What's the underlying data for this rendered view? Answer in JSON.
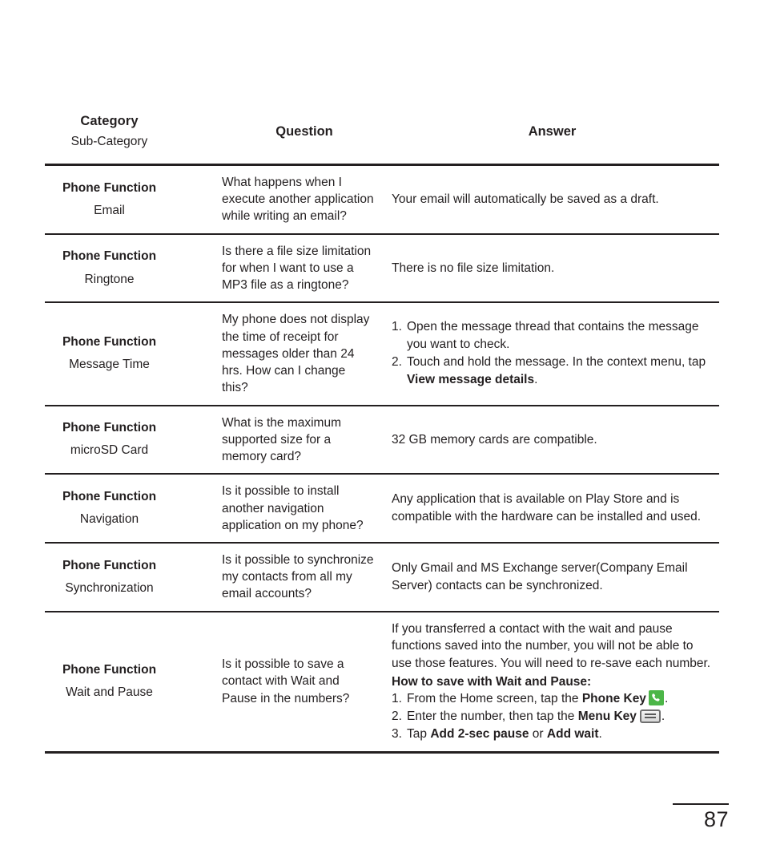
{
  "page": {
    "number": "87"
  },
  "table": {
    "headers": {
      "category": "Category",
      "sub_category": "Sub-Category",
      "question": "Question",
      "answer": "Answer"
    },
    "rows": [
      {
        "category": "Phone Function",
        "sub_category": "Email",
        "question": "What happens when I execute another application while writing an email?",
        "answer_lines": [
          "Your email will automatically be saved as a draft."
        ]
      },
      {
        "category": "Phone Function",
        "sub_category": "Ringtone",
        "question": "Is there a file size limitation for when I want to use a MP3 file as a ringtone?",
        "answer_lines": [
          "There is no file size limitation."
        ]
      },
      {
        "category": "Phone Function",
        "sub_category": "Message Time",
        "question": "My phone does not display the time of receipt for messages older than 24 hrs. How can I change this?",
        "answer_steps": [
          {
            "num": "1.",
            "text": "Open the message thread that contains the message you want to check."
          },
          {
            "num": "2.",
            "text_before": "Touch and hold the message. In the context menu, tap ",
            "bold": "View message details",
            "text_after": "."
          }
        ]
      },
      {
        "category": "Phone Function",
        "sub_category": "microSD Card",
        "question": "What is the maximum supported size for a memory card?",
        "answer_lines": [
          "32 GB memory cards are compatible."
        ]
      },
      {
        "category": "Phone Function",
        "sub_category": "Navigation",
        "question": "Is it possible to install another navigation application on my phone?",
        "answer_lines": [
          "Any application that is available on Play Store and is compatible with the hardware can be installed and used."
        ]
      },
      {
        "category": "Phone Function",
        "sub_category": "Synchronization",
        "question": "Is it possible to synchronize my contacts from all my email accounts?",
        "answer_lines": [
          "Only Gmail and MS Exchange server(Company Email Server) contacts can be synchronized."
        ]
      },
      {
        "category": "Phone Function",
        "sub_category": "Wait and Pause",
        "question": "Is it possible to save a contact with Wait and Pause in the numbers?",
        "answer_intro": "If you transferred a contact with the wait and pause functions saved into the number, you will not be able to use those features. You will need to re-save each number.",
        "answer_how_heading": "How to save with Wait and Pause:",
        "answer_steps": [
          {
            "num": "1.",
            "text_before": "From the Home screen, tap the ",
            "bold": "Phone Key",
            "icon": "phone-key-icon",
            "text_after": "."
          },
          {
            "num": "2.",
            "text_before": "Enter the number, then tap the ",
            "bold": "Menu Key",
            "icon": "menu-key-icon",
            "text_after": "."
          },
          {
            "num": "3.",
            "text_before": "Tap ",
            "bold": "Add 2-sec pause",
            "text_mid": " or ",
            "bold2": "Add wait",
            "text_after": "."
          }
        ]
      }
    ]
  },
  "colors": {
    "text": "#231f20",
    "rule": "#231f20",
    "phone_key_green": "#4cb648",
    "menu_key_gray": "#6f6f6f"
  }
}
